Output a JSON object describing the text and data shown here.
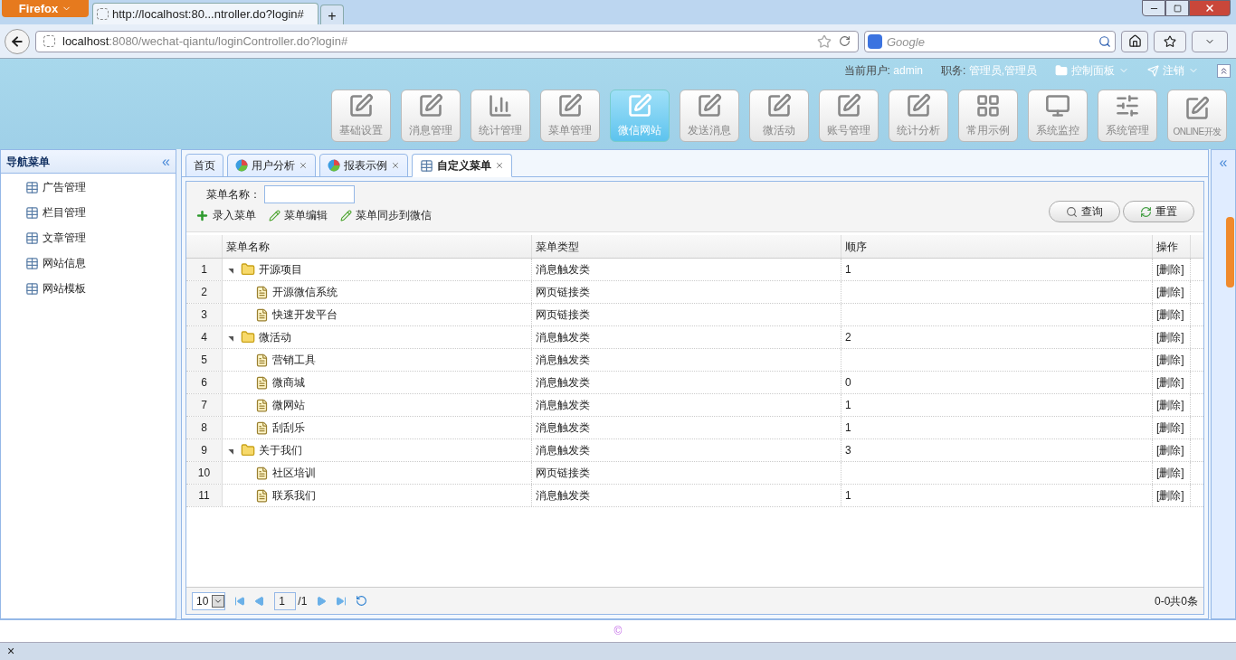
{
  "browser": {
    "menu_button": "Firefox",
    "tabs": [
      {
        "title": "http://localhost:80...ntroller.do?login#",
        "selected": true
      }
    ],
    "new_tab": "+",
    "url_host": "localhost",
    "url_rest": ":8080/wechat-qiantu/loginController.do?login#",
    "search_placeholder": "Google"
  },
  "header": {
    "user_label": "当前用户:",
    "user": "admin",
    "role_label": "职务:",
    "role": "管理员,管理员",
    "control_panel": "控制面板",
    "logout": "注销",
    "modules": [
      {
        "label": "基础设置",
        "kind": "edit",
        "selected": false
      },
      {
        "label": "消息管理",
        "kind": "edit",
        "selected": false
      },
      {
        "label": "统计管理",
        "kind": "chart",
        "selected": false
      },
      {
        "label": "菜单管理",
        "kind": "edit",
        "selected": false
      },
      {
        "label": "微信网站",
        "kind": "edit",
        "selected": true
      },
      {
        "label": "发送消息",
        "kind": "edit",
        "selected": false
      },
      {
        "label": "微活动",
        "kind": "edit",
        "selected": false
      },
      {
        "label": "账号管理",
        "kind": "edit",
        "selected": false
      },
      {
        "label": "统计分析",
        "kind": "edit",
        "selected": false
      },
      {
        "label": "常用示例",
        "kind": "grid",
        "selected": false
      },
      {
        "label": "系统监控",
        "kind": "monitor",
        "selected": false
      },
      {
        "label": "系统管理",
        "kind": "sliders",
        "selected": false
      },
      {
        "label": "ONLINE开发",
        "kind": "edit",
        "selected": false
      }
    ]
  },
  "sidebar": {
    "title": "导航菜单",
    "collapse": "«",
    "items": [
      {
        "label": "广告管理"
      },
      {
        "label": "栏目管理"
      },
      {
        "label": "文章管理"
      },
      {
        "label": "网站信息"
      },
      {
        "label": "网站模板"
      }
    ]
  },
  "tabs": [
    {
      "label": "首页",
      "kind": "plain",
      "closable": false,
      "selected": false
    },
    {
      "label": "用户分析",
      "kind": "chart",
      "closable": true,
      "selected": false
    },
    {
      "label": "报表示例",
      "kind": "chart",
      "closable": true,
      "selected": false
    },
    {
      "label": "自定义菜单",
      "kind": "table",
      "closable": true,
      "selected": true
    }
  ],
  "search": {
    "label": "菜单名称："
  },
  "actions": [
    {
      "label": "录入菜单",
      "kind": "add"
    },
    {
      "label": "菜单编辑",
      "kind": "edit"
    },
    {
      "label": "菜单同步到微信",
      "kind": "edit"
    }
  ],
  "buttons": [
    {
      "label": "查询",
      "kind": "search"
    },
    {
      "label": "重置",
      "kind": "reset"
    }
  ],
  "table": {
    "columns": [
      "菜单名称",
      "菜单类型",
      "顺序",
      "操作"
    ],
    "rows": [
      {
        "num": "1",
        "name": "开源项目",
        "type": "消息触发类",
        "order": "1",
        "op": "[删除]",
        "expanded": true,
        "children": [
          {
            "num": "2",
            "name": "开源微信系统",
            "type": "网页链接类",
            "op": "[删除]"
          },
          {
            "num": "3",
            "name": "快速开发平台",
            "type": "网页链接类",
            "op": "[删除]"
          }
        ]
      },
      {
        "num": "4",
        "name": "微活动",
        "type": "消息触发类",
        "order": "2",
        "op": "[删除]",
        "expanded": true,
        "children": [
          {
            "num": "5",
            "name": "营销工具",
            "type": "消息触发类",
            "op": "[删除]"
          },
          {
            "num": "6",
            "name": "微商城",
            "type": "消息触发类",
            "order": "0",
            "op": "[删除]"
          },
          {
            "num": "7",
            "name": "微网站",
            "type": "消息触发类",
            "order": "1",
            "op": "[删除]"
          },
          {
            "num": "8",
            "name": "刮刮乐",
            "type": "消息触发类",
            "order": "1",
            "op": "[删除]"
          }
        ]
      },
      {
        "num": "9",
        "name": "关于我们",
        "type": "消息触发类",
        "order": "3",
        "op": "[删除]",
        "expanded": true,
        "children": [
          {
            "num": "10",
            "name": "社区培训",
            "type": "网页链接类",
            "op": "[删除]"
          },
          {
            "num": "11",
            "name": "联系我们",
            "type": "消息触发类",
            "order": "1",
            "op": "[删除]"
          }
        ]
      }
    ]
  },
  "pager": {
    "page_size": "10",
    "page": "1",
    "pages": "/1",
    "summary": "0-0共0条"
  },
  "footer": {
    "text": "©"
  },
  "status_bar": {
    "close": "×"
  },
  "right_panel": {
    "expand": "«"
  }
}
